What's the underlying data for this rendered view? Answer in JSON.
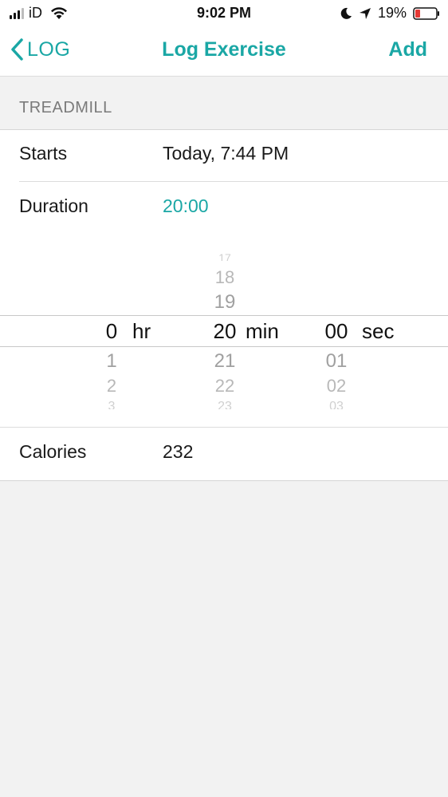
{
  "status_bar": {
    "carrier": "iD",
    "time": "9:02 PM",
    "battery_percent": "19%",
    "icons": [
      "signal-icon",
      "wifi-icon",
      "moon-icon",
      "location-icon",
      "battery-icon"
    ]
  },
  "nav": {
    "back_label": "LOG",
    "title": "Log Exercise",
    "action_label": "Add",
    "accent_color": "#1aa7a5"
  },
  "section": {
    "title": "TREADMILL"
  },
  "rows": {
    "starts": {
      "label": "Starts",
      "value": "Today, 7:44 PM"
    },
    "duration": {
      "label": "Duration",
      "value": "20:00"
    },
    "calories": {
      "label": "Calories",
      "value": "232"
    }
  },
  "picker": {
    "hours": {
      "above": [],
      "selected": "0",
      "below": [
        "1",
        "2",
        "3"
      ],
      "unit": "hr"
    },
    "minutes": {
      "above": [
        "17",
        "18",
        "19"
      ],
      "selected": "20",
      "below": [
        "21",
        "22",
        "23"
      ],
      "unit": "min"
    },
    "seconds": {
      "above": [],
      "selected": "00",
      "below": [
        "01",
        "02",
        "03"
      ],
      "unit": "sec"
    }
  }
}
